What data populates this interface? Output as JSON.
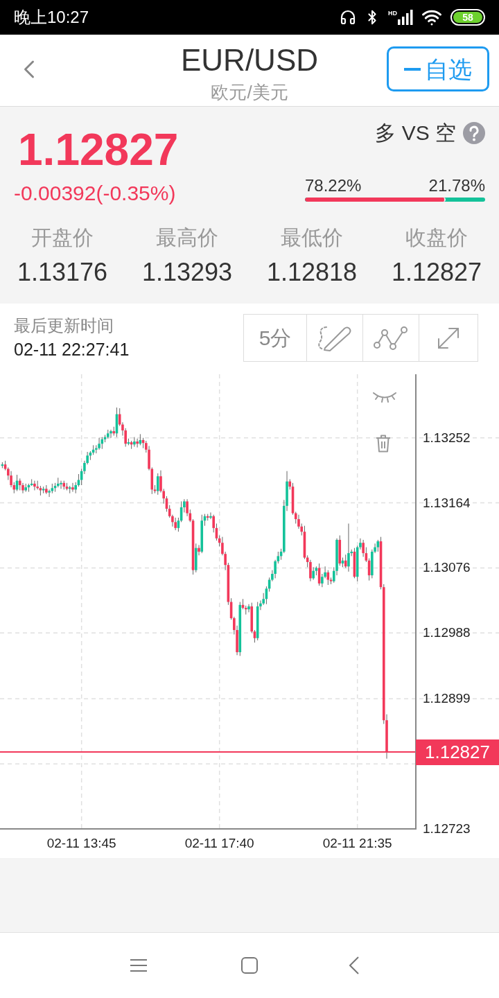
{
  "status_bar": {
    "time": "晚上10:27",
    "network_label": "HD",
    "battery": "58"
  },
  "header": {
    "title": "EUR/USD",
    "subtitle": "欧元/美元",
    "watch_button": {
      "label": "自选",
      "in_watchlist": true
    }
  },
  "quote": {
    "price": "1.12827",
    "change": "-0.00392(-0.35%)"
  },
  "sentiment": {
    "title": "多 VS 空",
    "long_label": "78.22%",
    "short_label": "21.78%",
    "level": 0.7822
  },
  "stats": [
    {
      "label": "开盘价",
      "value": "1.13176"
    },
    {
      "label": "最高价",
      "value": "1.13293"
    },
    {
      "label": "最低价",
      "value": "1.12818"
    },
    {
      "label": "收盘价",
      "value": "1.12827"
    }
  ],
  "update": {
    "label": "最后更新时间",
    "time": "02-11 22:27:41"
  },
  "toolbar": [
    {
      "kind": "text",
      "label": "5分"
    },
    {
      "kind": "draw"
    },
    {
      "kind": "indicator"
    },
    {
      "kind": "expand"
    }
  ],
  "chart": {
    "chart_data": {
      "type": "candlestick",
      "grid": true,
      "ylim": [
        1.12723,
        1.13338
      ],
      "yticks": [
        1.13252,
        1.13164,
        1.13076,
        1.12988,
        1.12899,
        {
          "value": 1.12811,
          "label": null
        },
        1.12723
      ],
      "ref_lines": [
        {
          "axis": "y",
          "value": 1.12827,
          "label": "1.12827",
          "color": "#f2385a"
        }
      ],
      "categories": [
        null,
        null,
        null,
        null,
        null,
        null,
        null,
        null,
        null,
        null,
        null,
        null,
        null,
        null,
        null,
        null,
        null,
        null,
        null,
        null,
        null,
        null,
        null,
        null,
        null,
        null,
        null,
        "02-11 13:45",
        null,
        null,
        null,
        null,
        null,
        null,
        null,
        null,
        null,
        null,
        null,
        null,
        null,
        null,
        null,
        null,
        null,
        null,
        null,
        null,
        null,
        null,
        null,
        null,
        null,
        null,
        null,
        null,
        null,
        null,
        null,
        null,
        null,
        null,
        null,
        null,
        null,
        null,
        null,
        null,
        null,
        null,
        null,
        null,
        null,
        null,
        "02-11 17:40",
        null,
        null,
        null,
        null,
        null,
        null,
        null,
        null,
        null,
        null,
        null,
        null,
        null,
        null,
        null,
        null,
        null,
        null,
        null,
        null,
        null,
        null,
        null,
        null,
        null,
        null,
        null,
        null,
        null,
        null,
        null,
        null,
        null,
        null,
        null,
        null,
        null,
        null,
        null,
        null,
        null,
        null,
        null,
        null,
        null,
        null,
        "02-11 21:35",
        null,
        null,
        null,
        null,
        null,
        null,
        null,
        null,
        null,
        null
      ],
      "ohlc": [
        [
          1.13215,
          1.13219,
          1.13211,
          1.13216
        ],
        [
          1.13216,
          1.13221,
          1.13208,
          1.1321
        ],
        [
          1.1321,
          1.13212,
          1.13195,
          1.13201
        ],
        [
          1.13201,
          1.13207,
          1.13185,
          1.13188
        ],
        [
          1.13188,
          1.13192,
          1.13177,
          1.13182
        ],
        [
          1.13182,
          1.13202,
          1.1318,
          1.13194
        ],
        [
          1.13194,
          1.13197,
          1.13181,
          1.13188
        ],
        [
          1.13188,
          1.13191,
          1.13177,
          1.13181
        ],
        [
          1.13181,
          1.1319,
          1.13179,
          1.13185
        ],
        [
          1.13185,
          1.1319,
          1.13179,
          1.13188
        ],
        [
          1.13188,
          1.13196,
          1.13187,
          1.1319
        ],
        [
          1.1319,
          1.13194,
          1.13181,
          1.13186
        ],
        [
          1.13186,
          1.13194,
          1.13182,
          1.13184
        ],
        [
          1.13184,
          1.13187,
          1.13174,
          1.13181
        ],
        [
          1.13181,
          1.13186,
          1.13177,
          1.13183
        ],
        [
          1.13183,
          1.13188,
          1.13176,
          1.13178
        ],
        [
          1.13178,
          1.13182,
          1.13172,
          1.1318
        ],
        [
          1.1318,
          1.1319,
          1.13177,
          1.13184
        ],
        [
          1.13184,
          1.13191,
          1.13179,
          1.13187
        ],
        [
          1.13187,
          1.13198,
          1.13185,
          1.1319
        ],
        [
          1.1319,
          1.13194,
          1.13183,
          1.13191
        ],
        [
          1.13191,
          1.13194,
          1.13182,
          1.13186
        ],
        [
          1.13186,
          1.13191,
          1.13181,
          1.13183
        ],
        [
          1.13183,
          1.13187,
          1.13177,
          1.13185
        ],
        [
          1.13185,
          1.13191,
          1.13179,
          1.13182
        ],
        [
          1.13182,
          1.13192,
          1.13177,
          1.13188
        ],
        [
          1.13188,
          1.13203,
          1.13186,
          1.13195
        ],
        [
          1.13195,
          1.1321,
          1.13188,
          1.13207
        ],
        [
          1.13207,
          1.13221,
          1.13203,
          1.13218
        ],
        [
          1.13218,
          1.13233,
          1.13216,
          1.13228
        ],
        [
          1.13228,
          1.13234,
          1.13222,
          1.13232
        ],
        [
          1.13232,
          1.13242,
          1.13229,
          1.13236
        ],
        [
          1.13236,
          1.13242,
          1.13231,
          1.13238
        ],
        [
          1.13238,
          1.13252,
          1.13236,
          1.13244
        ],
        [
          1.13244,
          1.13253,
          1.13237,
          1.1325
        ],
        [
          1.1325,
          1.13256,
          1.13246,
          1.13253
        ],
        [
          1.13253,
          1.13263,
          1.13251,
          1.13258
        ],
        [
          1.13258,
          1.13263,
          1.13252,
          1.13261
        ],
        [
          1.13261,
          1.13267,
          1.13255,
          1.13258
        ],
        [
          1.13258,
          1.13293,
          1.13253,
          1.13284
        ],
        [
          1.13284,
          1.13292,
          1.13268,
          1.1327
        ],
        [
          1.1327,
          1.13273,
          1.13255,
          1.13262
        ],
        [
          1.13262,
          1.13265,
          1.1324,
          1.13244
        ],
        [
          1.13244,
          1.13251,
          1.13242,
          1.13246
        ],
        [
          1.13246,
          1.13248,
          1.13237,
          1.13243
        ],
        [
          1.13243,
          1.13253,
          1.1324,
          1.13247
        ],
        [
          1.13247,
          1.13251,
          1.13239,
          1.13244
        ],
        [
          1.13244,
          1.13257,
          1.13242,
          1.13249
        ],
        [
          1.13249,
          1.13252,
          1.13238,
          1.13245
        ],
        [
          1.13245,
          1.13248,
          1.13232,
          1.13236
        ],
        [
          1.13236,
          1.13241,
          1.13208,
          1.1321
        ],
        [
          1.1321,
          1.13212,
          1.13176,
          1.13182
        ],
        [
          1.13182,
          1.13188,
          1.13177,
          1.1318
        ],
        [
          1.1318,
          1.13204,
          1.13175,
          1.132
        ],
        [
          1.132,
          1.13208,
          1.13178,
          1.1318
        ],
        [
          1.1318,
          1.13183,
          1.13163,
          1.1317
        ],
        [
          1.1317,
          1.13173,
          1.13152,
          1.13156
        ],
        [
          1.13156,
          1.13161,
          1.13144,
          1.13146
        ],
        [
          1.13146,
          1.13148,
          1.13132,
          1.13138
        ],
        [
          1.13138,
          1.13144,
          1.13127,
          1.1313
        ],
        [
          1.1313,
          1.13144,
          1.13125,
          1.1314
        ],
        [
          1.1314,
          1.13166,
          1.13138,
          1.13158
        ],
        [
          1.13158,
          1.13169,
          1.13151,
          1.13166
        ],
        [
          1.13166,
          1.13169,
          1.13146,
          1.1315
        ],
        [
          1.1315,
          1.13155,
          1.13138,
          1.1314
        ],
        [
          1.1314,
          1.13142,
          1.13067,
          1.13073
        ],
        [
          1.13073,
          1.13109,
          1.1307,
          1.13103
        ],
        [
          1.13103,
          1.13107,
          1.13093,
          1.13098
        ],
        [
          1.13098,
          1.13148,
          1.13096,
          1.1314
        ],
        [
          1.1314,
          1.13149,
          1.13133,
          1.13146
        ],
        [
          1.13146,
          1.13149,
          1.1314,
          1.13144
        ],
        [
          1.13144,
          1.13151,
          1.13142,
          1.13146
        ],
        [
          1.13146,
          1.13148,
          1.13124,
          1.1313
        ],
        [
          1.1313,
          1.13136,
          1.13113,
          1.13116
        ],
        [
          1.13116,
          1.1312,
          1.13105,
          1.1311
        ],
        [
          1.1311,
          1.13118,
          1.13093,
          1.13095
        ],
        [
          1.13095,
          1.13098,
          1.13073,
          1.1308
        ],
        [
          1.1308,
          1.13083,
          1.13026,
          1.1303
        ],
        [
          1.1303,
          1.13035,
          1.13006,
          1.13008
        ],
        [
          1.13008,
          1.1301,
          1.12986,
          1.12992
        ],
        [
          1.12992,
          1.12998,
          1.12958,
          1.12962
        ],
        [
          1.12962,
          1.1303,
          1.12957,
          1.13026
        ],
        [
          1.13026,
          1.13034,
          1.1302,
          1.13022
        ],
        [
          1.13022,
          1.13025,
          1.13013,
          1.1302
        ],
        [
          1.1302,
          1.13027,
          1.13016,
          1.13024
        ],
        [
          1.13024,
          1.13029,
          1.12988,
          1.1299
        ],
        [
          1.1299,
          1.12992,
          1.12975,
          1.12981
        ],
        [
          1.12981,
          1.1303,
          1.12978,
          1.13024
        ],
        [
          1.13024,
          1.13032,
          1.13019,
          1.13028
        ],
        [
          1.13028,
          1.13042,
          1.13026,
          1.13034
        ],
        [
          1.13034,
          1.13051,
          1.13027,
          1.13048
        ],
        [
          1.13048,
          1.13063,
          1.13044,
          1.1306
        ],
        [
          1.1306,
          1.13073,
          1.13058,
          1.13068
        ],
        [
          1.13068,
          1.13087,
          1.13062,
          1.13085
        ],
        [
          1.13085,
          1.13098,
          1.13082,
          1.13092
        ],
        [
          1.13092,
          1.13102,
          1.13087,
          1.13098
        ],
        [
          1.13098,
          1.13168,
          1.13096,
          1.1316
        ],
        [
          1.1316,
          1.13207,
          1.13153,
          1.13193
        ],
        [
          1.13193,
          1.13196,
          1.13182,
          1.13186
        ],
        [
          1.13186,
          1.13191,
          1.13148,
          1.1315
        ],
        [
          1.1315,
          1.13152,
          1.13136,
          1.13142
        ],
        [
          1.13142,
          1.13148,
          1.13129,
          1.13132
        ],
        [
          1.13132,
          1.13136,
          1.1312,
          1.13125
        ],
        [
          1.13125,
          1.13133,
          1.13088,
          1.1309
        ],
        [
          1.1309,
          1.13093,
          1.13077,
          1.13084
        ],
        [
          1.13084,
          1.13087,
          1.13058,
          1.13062
        ],
        [
          1.13062,
          1.13077,
          1.1306,
          1.13072
        ],
        [
          1.13072,
          1.13078,
          1.13066,
          1.13076
        ],
        [
          1.13076,
          1.13082,
          1.13052,
          1.13055
        ],
        [
          1.13055,
          1.13068,
          1.1305,
          1.13064
        ],
        [
          1.13064,
          1.13078,
          1.13062,
          1.1307
        ],
        [
          1.1307,
          1.13073,
          1.13053,
          1.1306
        ],
        [
          1.1306,
          1.13063,
          1.13054,
          1.13058
        ],
        [
          1.13058,
          1.13077,
          1.13056,
          1.13072
        ],
        [
          1.13072,
          1.13116,
          1.13066,
          1.13114
        ],
        [
          1.13114,
          1.1312,
          1.13079,
          1.13082
        ],
        [
          1.13082,
          1.1309,
          1.13077,
          1.13086
        ],
        [
          1.13086,
          1.13094,
          1.13076,
          1.13078
        ],
        [
          1.13078,
          1.13136,
          1.13071,
          1.13096
        ],
        [
          1.13096,
          1.13101,
          1.13092,
          1.13098
        ],
        [
          1.13098,
          1.13103,
          1.13062,
          1.13064
        ],
        [
          1.13064,
          1.13106,
          1.13058,
          1.13104
        ],
        [
          1.13104,
          1.13116,
          1.13101,
          1.1311
        ],
        [
          1.1311,
          1.13114,
          1.13091,
          1.13096
        ],
        [
          1.13096,
          1.13104,
          1.13084,
          1.13086
        ],
        [
          1.13086,
          1.13089,
          1.13059,
          1.13066
        ],
        [
          1.13066,
          1.13101,
          1.13062,
          1.13098
        ],
        [
          1.13098,
          1.13109,
          1.13096,
          1.13104
        ],
        [
          1.13104,
          1.13114,
          1.13098,
          1.13112
        ],
        [
          1.13112,
          1.13118,
          1.13047,
          1.1305
        ],
        [
          1.1305,
          1.13054,
          1.12865,
          1.1287
        ],
        [
          1.1287,
          1.12878,
          1.12818,
          1.12827
        ]
      ]
    }
  }
}
